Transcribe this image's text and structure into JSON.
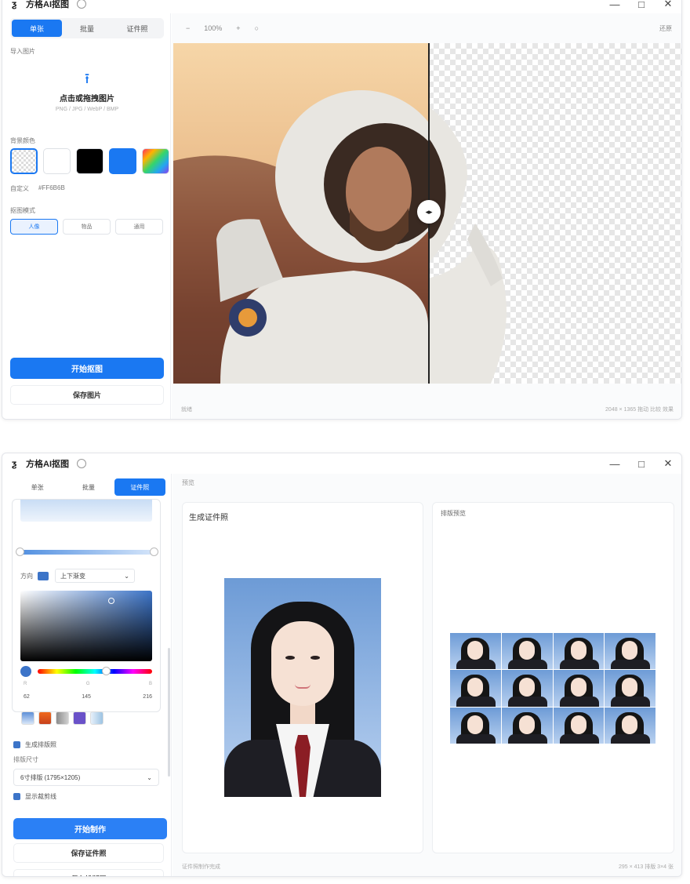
{
  "window1": {
    "title": "方格AI抠图",
    "tabs": [
      "单张",
      "批量",
      "证件照"
    ],
    "active_tab": 0,
    "import_label": "导入图片",
    "upload_title": "点击或拖拽图片",
    "upload_hint": "PNG / JPG / WebP / BMP",
    "bg_color_label": "背景颜色",
    "swatches": [
      "transparent",
      "#ffffff",
      "#000000",
      "#1a78f2",
      "gradient"
    ],
    "custom_label": "自定义",
    "custom_value": "#FF6B6B",
    "mode_label": "抠图模式",
    "modes": [
      "人像",
      "物品",
      "通用"
    ],
    "start_button": "开始抠图",
    "save_button": "保存图片",
    "toolbar": {
      "zoom_out": "−",
      "zoom_value": "100%",
      "zoom_in": "+",
      "reset": "还原"
    },
    "status_left": "就绪",
    "status_right": "2048 × 1365   拖动 比较 效果"
  },
  "window2": {
    "title": "方格AI抠图",
    "tabs": [
      "单张",
      "批量",
      "证件照"
    ],
    "active_tab": 2,
    "direction_label": "方向",
    "direction_value": "上下渐变",
    "rgb_labels": [
      "R",
      "G",
      "B"
    ],
    "rgb_values": [
      "62",
      "145",
      "216"
    ],
    "preset_colors": [
      "#8fb4ea",
      "#e24b1e",
      "#a7a7a7",
      "#6a52c9",
      "#a9cde8"
    ],
    "check_layout_label": "生成排版照",
    "layout_size_label": "排版尺寸",
    "layout_size_value": "6寸排版 (1795×1205)",
    "check_border_label": "显示裁剪线",
    "make_button": "开始制作",
    "save_id_button": "保存证件照",
    "save_layout_button": "保存排版照",
    "breadcrumb": "预览",
    "panel_left_title": "生成证件照",
    "panel_right_title": "排版预览",
    "status_left": "证件照制作完成",
    "status_right": "295 × 413   排版 3×4 张"
  }
}
